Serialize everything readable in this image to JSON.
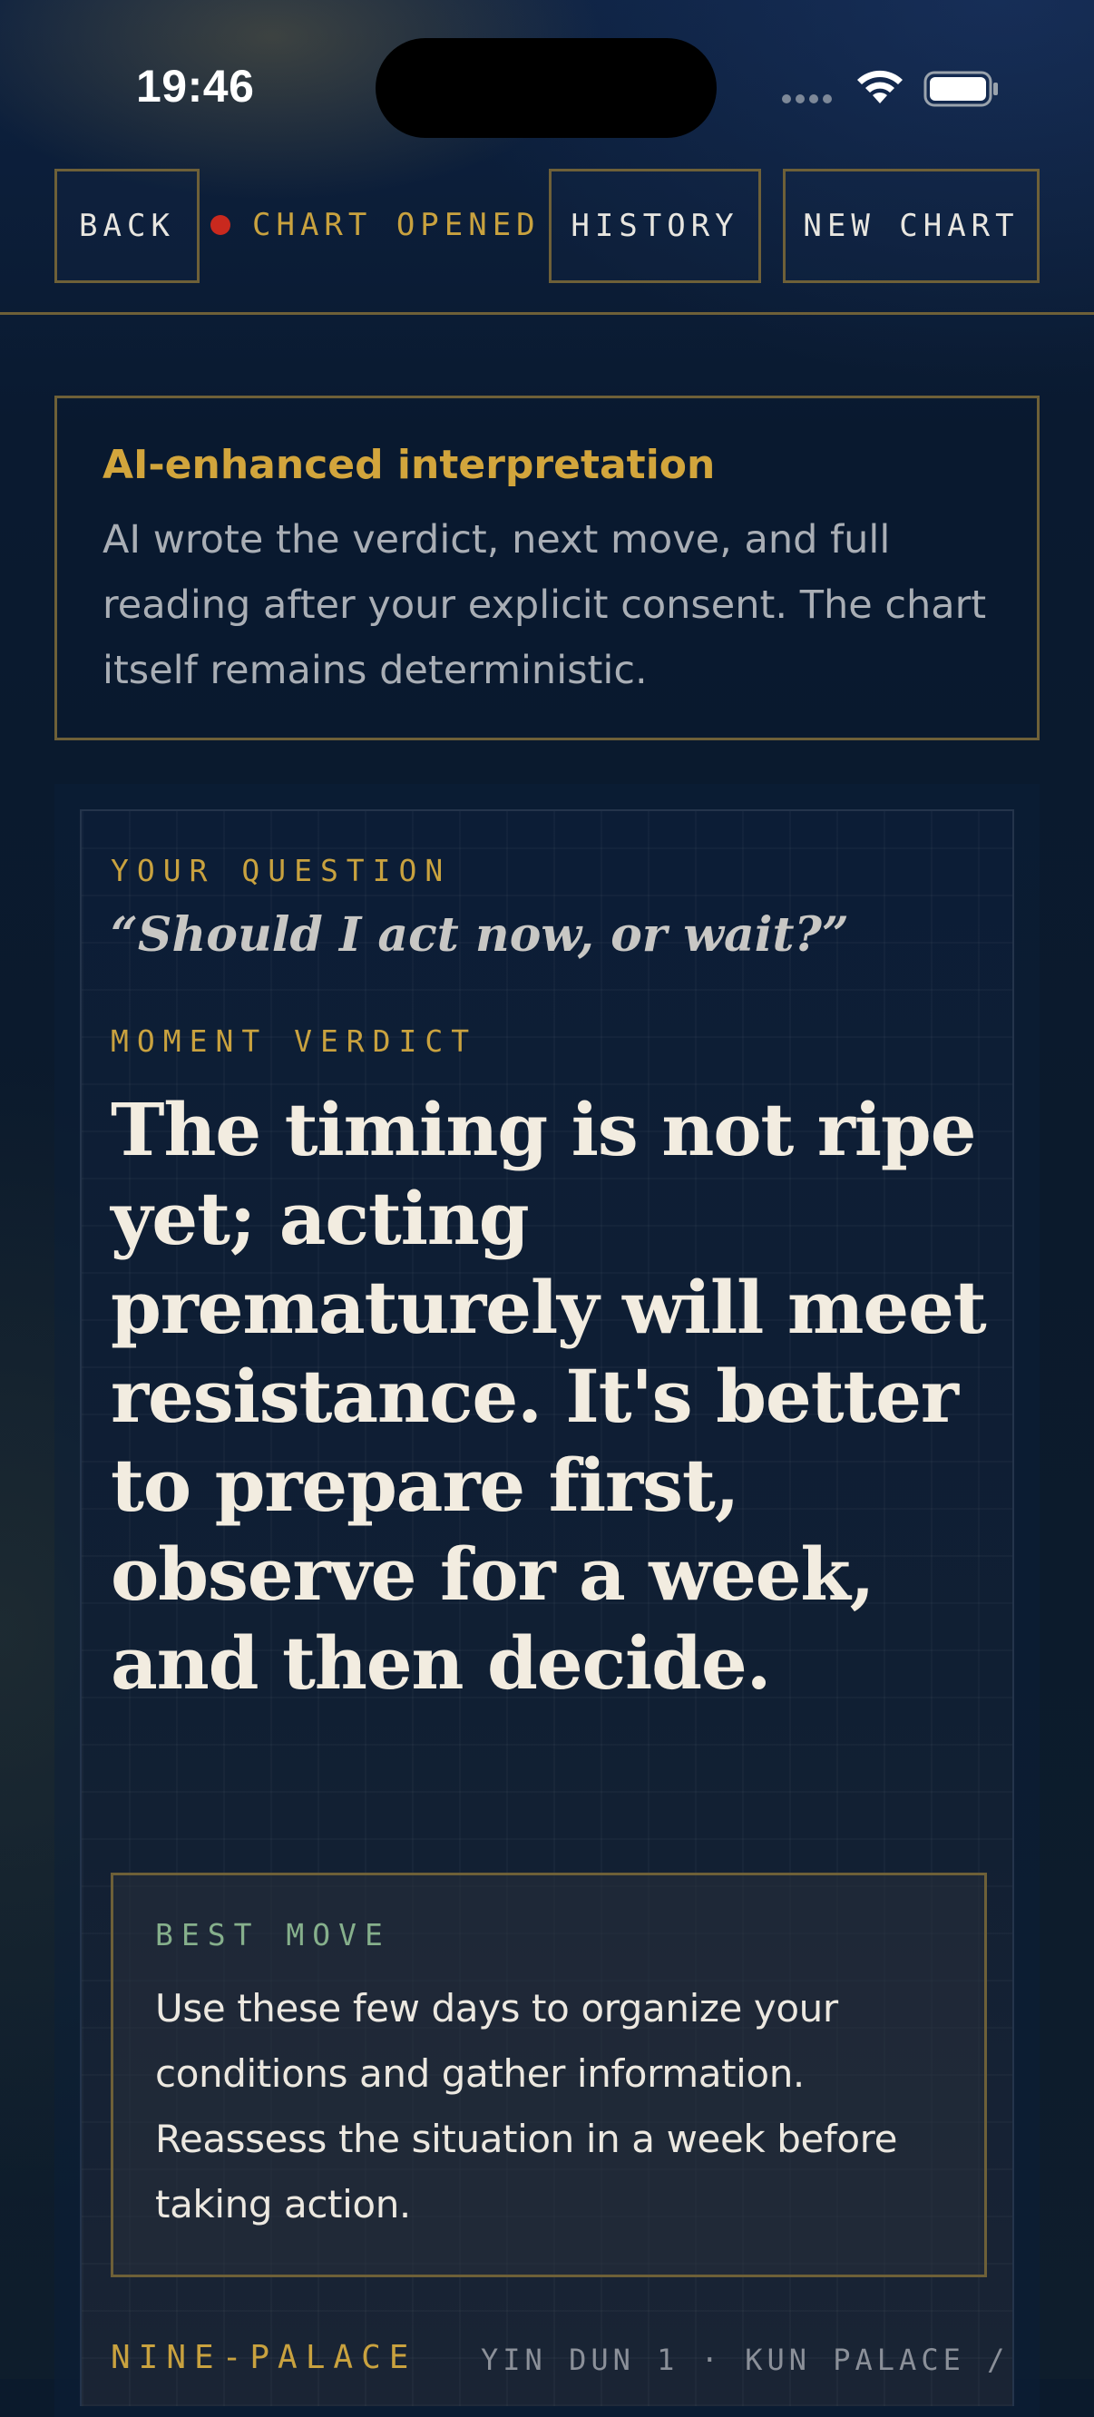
{
  "status_bar": {
    "time": "19:46"
  },
  "nav": {
    "back_label": "BACK",
    "status_label": "CHART OPENED",
    "history_label": "HISTORY",
    "new_chart_label": "NEW CHART"
  },
  "ai_notice": {
    "title": "AI-enhanced interpretation",
    "body": "AI wrote the verdict, next move, and full reading after your explicit consent. The chart itself remains deterministic."
  },
  "reading": {
    "question_label": "YOUR QUESTION",
    "question": "“Should I act now, or wait?”",
    "verdict_label": "MOMENT VERDICT",
    "verdict": "The timing is not ripe yet; acting prematurely will meet resistance. It's better to prepare first, observe for a week, and then decide.",
    "best_move_label": "BEST MOVE",
    "best_move": "Use these few days to organize your conditions and gather information. Reassess the situation in a week before taking action.",
    "nine_palace_label": "NINE-PALACE",
    "nine_palace_meta": "YIN DUN 1 · KUN PALACE /"
  },
  "colors": {
    "accent_gold": "#c9a23f",
    "status_red": "#c9291e",
    "best_move_green": "#86b08c",
    "background": "#0b1a2c"
  },
  "icons": [
    "cellular-signal-icon",
    "wifi-icon",
    "battery-icon",
    "status-dot-icon"
  ]
}
